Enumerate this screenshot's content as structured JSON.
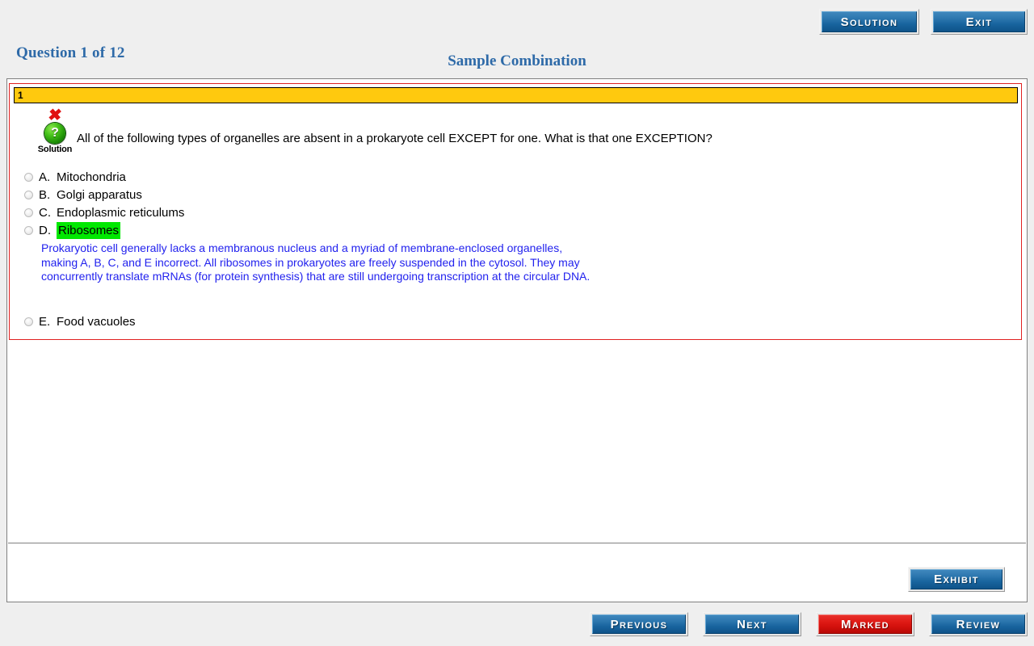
{
  "header": {
    "question_counter": "Question 1 of 12",
    "exam_title": "Sample Combination",
    "solution_button": "Solution",
    "exit_button": "Exit"
  },
  "question": {
    "number": "1",
    "marker_icon": "red-x-icon",
    "solution_icon": "green-question-orb-icon",
    "solution_icon_label": "Solution",
    "text": "All of the following types of organelles are absent in a prokaryote cell EXCEPT for one. What is that one EXCEPTION?",
    "options": [
      {
        "letter": "A.",
        "text": "Mitochondria",
        "highlighted": false,
        "selected": false
      },
      {
        "letter": "B.",
        "text": "Golgi apparatus",
        "highlighted": false,
        "selected": false
      },
      {
        "letter": "C.",
        "text": "Endoplasmic reticulums",
        "highlighted": false,
        "selected": false
      },
      {
        "letter": "D.",
        "text": "Ribosomes",
        "highlighted": true,
        "selected": false
      },
      {
        "letter": "E.",
        "text": "Food vacuoles",
        "highlighted": false,
        "selected": false
      }
    ],
    "explanation": "Prokaryotic cell generally lacks a membranous nucleus and a myriad of membrane-enclosed organelles, making A, B, C, and E incorrect. All ribosomes in prokaryotes are freely suspended in the cytosol. They may concurrently translate mRNAs (for protein synthesis) that are still undergoing transcription at the circular DNA."
  },
  "toolbar": {
    "exhibit_button": "Exhibit"
  },
  "footer": {
    "previous_button": "Previous",
    "next_button": "Next",
    "marked_button": "Marked",
    "review_button": "Review"
  },
  "colors": {
    "page_background": "#efefef",
    "heading_blue": "#2e6aa8",
    "button_blue": "#18649e",
    "marked_red": "#d2100c",
    "question_bar_yellow": "#ffc90e",
    "question_box_border": "#e02020",
    "highlight_green": "#00e800",
    "explanation_blue": "#2222ee"
  }
}
